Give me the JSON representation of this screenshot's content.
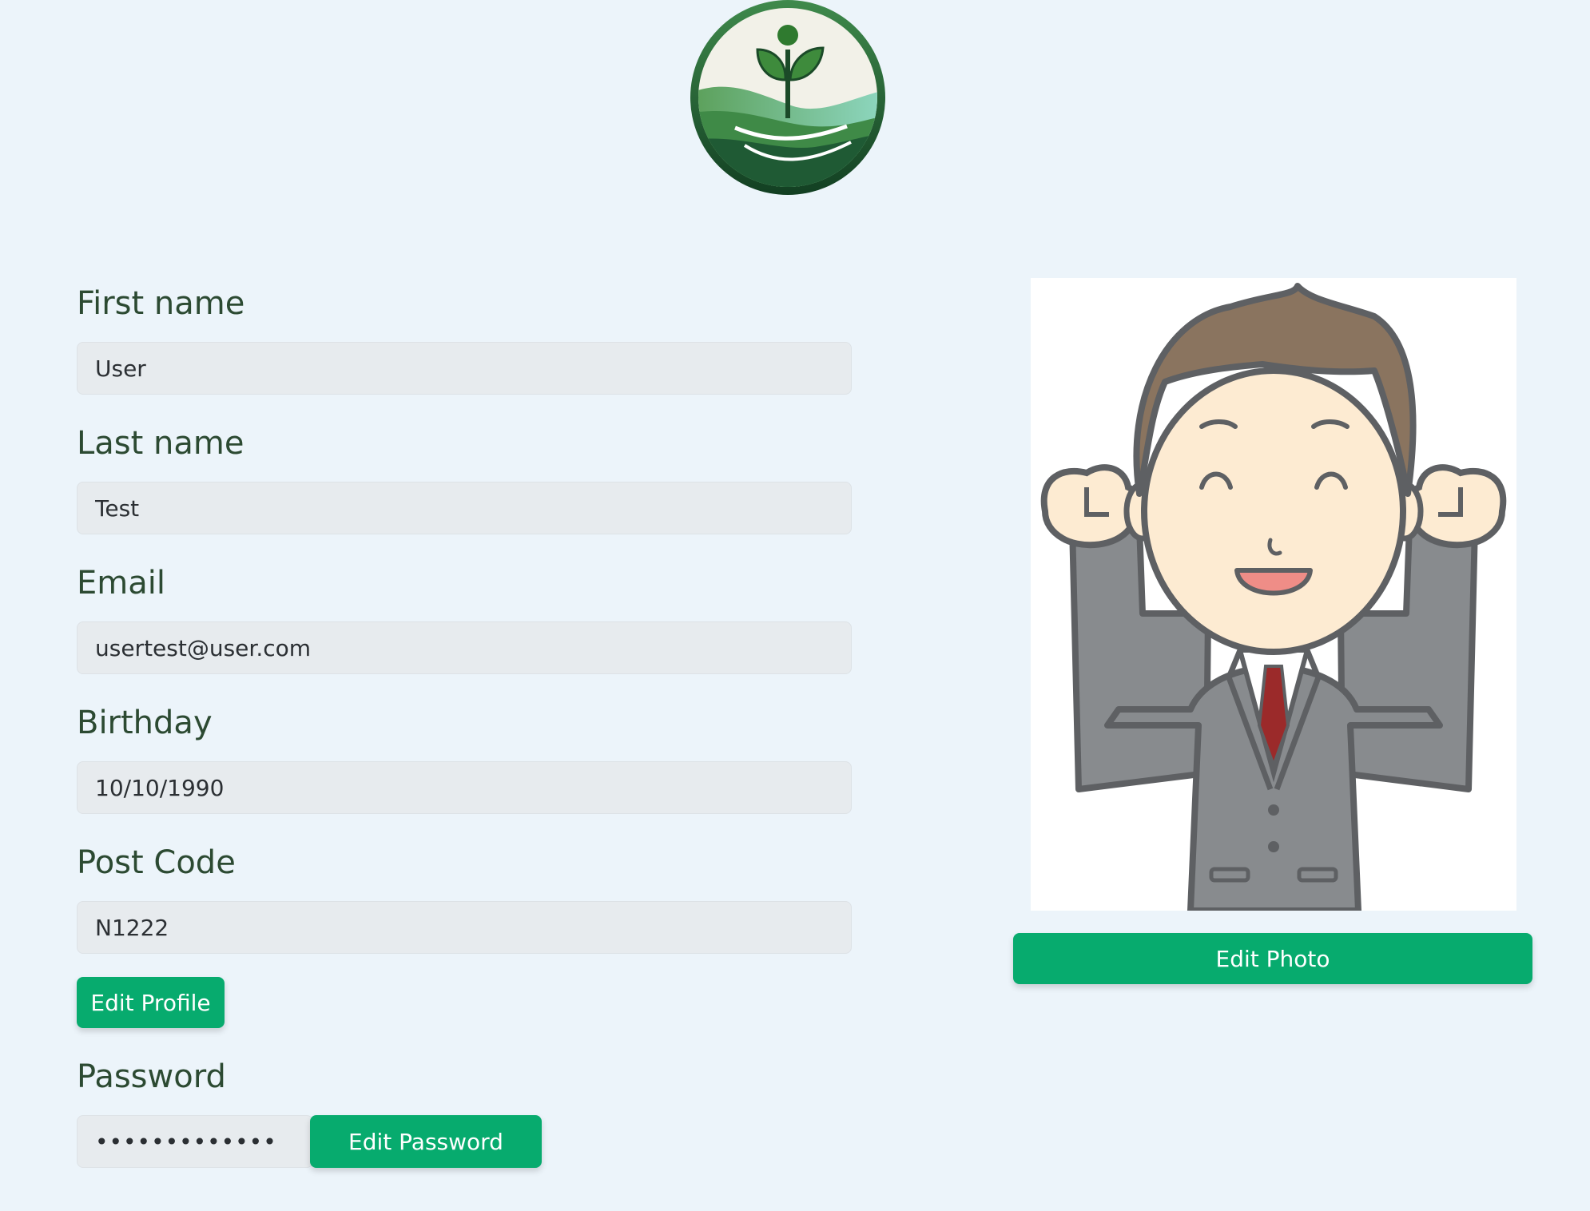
{
  "logo": {
    "icon": "sprout-logo-icon",
    "colors": {
      "dark_green": "#1f5a34",
      "leaf_green": "#3a8a3a",
      "teal": "#7fcfb5",
      "cream": "#f2f1e8"
    }
  },
  "form": {
    "first_name": {
      "label": "First name",
      "value": "User"
    },
    "last_name": {
      "label": "Last name",
      "value": "Test"
    },
    "email": {
      "label": "Email",
      "value": "usertest@user.com"
    },
    "birthday": {
      "label": "Birthday",
      "value": "10/10/1990"
    },
    "post_code": {
      "label": "Post Code",
      "value": "N1222"
    },
    "edit_profile_label": "Edit Profile",
    "password": {
      "label": "Password",
      "value": "•••••••••••••"
    },
    "edit_password_label": "Edit Password"
  },
  "photo": {
    "icon": "profile-avatar-icon",
    "edit_photo_label": "Edit Photo"
  },
  "colors": {
    "page_background": "#ecf4fa",
    "accent": "#07ab6e",
    "label_text": "#2c4a32",
    "input_background": "#e7ebee"
  }
}
